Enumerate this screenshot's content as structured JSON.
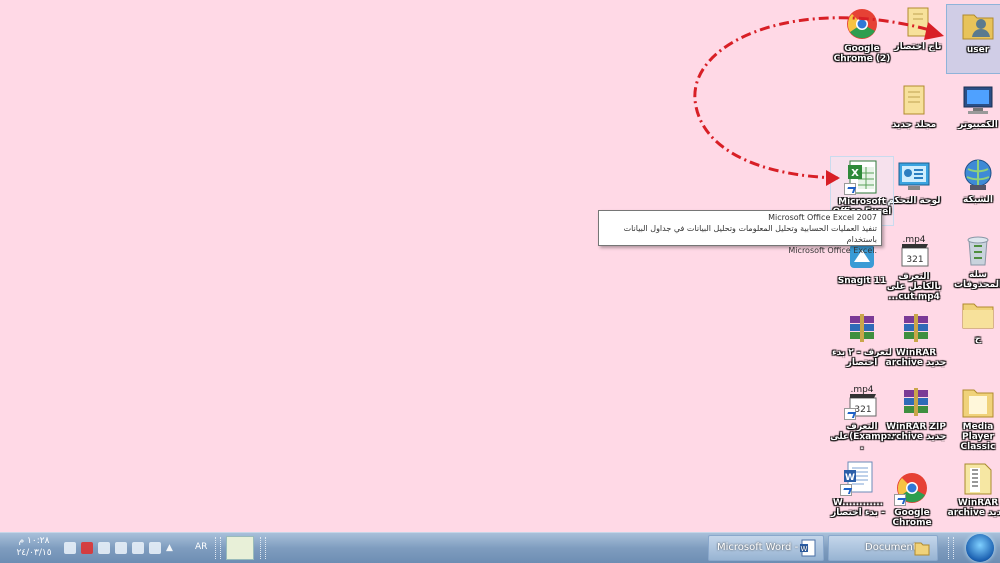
{
  "desktop_icons": [
    {
      "label": "user",
      "icon": "user-folder-icon",
      "selected": true
    },
    {
      "label": "تاج اختصار",
      "icon": "folder-icon"
    },
    {
      "label": "Google Chrome (2)",
      "icon": "chrome-icon"
    },
    {
      "label": "الكمبيوتر",
      "icon": "computer-icon"
    },
    {
      "label": "مجلد جديد",
      "icon": "folder-icon"
    },
    {
      "label": "الشبكة",
      "icon": "network-icon"
    },
    {
      "label": "لوحة التحكم",
      "icon": "control-panel-icon"
    },
    {
      "label": "Microsoft Office Excel",
      "icon": "excel-icon"
    },
    {
      "label": "سلة المحذوفات",
      "icon": "recycle-bin-icon"
    },
    {
      "label": "التعرف بالكامل على ...cut.mp4",
      "icon": "mp4-icon"
    },
    {
      "label": "Snagit 11",
      "icon": "snagit-icon"
    },
    {
      "label": "ج",
      "icon": "folder-icon"
    },
    {
      "label": "WinRAR archive جديد",
      "icon": "winrar-icon"
    },
    {
      "label": "لتعرف - ٢ بدء اختصار",
      "icon": "winrar-icon"
    },
    {
      "label": "Media Player Classic",
      "icon": "folder-icon"
    },
    {
      "label": "WinRAR ZIP archive جديد",
      "icon": "winrar-icon"
    },
    {
      "label": "التعرف على(Examp...",
      "icon": "mp4-icon"
    },
    {
      "label": "WinRAR archive جديد",
      "icon": "winrar-icon"
    },
    {
      "label": "Google Chrome",
      "icon": "chrome-icon"
    },
    {
      "label": "W............ بدء اختصار -",
      "icon": "word-doc-icon"
    }
  ],
  "tooltip": {
    "line1": "Microsoft Office Excel 2007",
    "line2": "تنفيذ العمليات الحسابية وتحليل المعلومات وتحليل البيانات في جداول البيانات باستخدام",
    "line3": "Microsoft Office Excel."
  },
  "taskbar": {
    "clock_time": "١٠:٢٨ م",
    "clock_date": "٢٤/٠٣/١٥",
    "lang": "AR",
    "tasks": [
      {
        "label": "Microsoft Word - ...",
        "icon": "word-icon"
      },
      {
        "label": "Documents",
        "icon": "folder-icon"
      }
    ]
  },
  "colors": {
    "desktop": "#ffd9e6",
    "arrow": "#d81f26",
    "taskbar": "#7f9dbf"
  }
}
